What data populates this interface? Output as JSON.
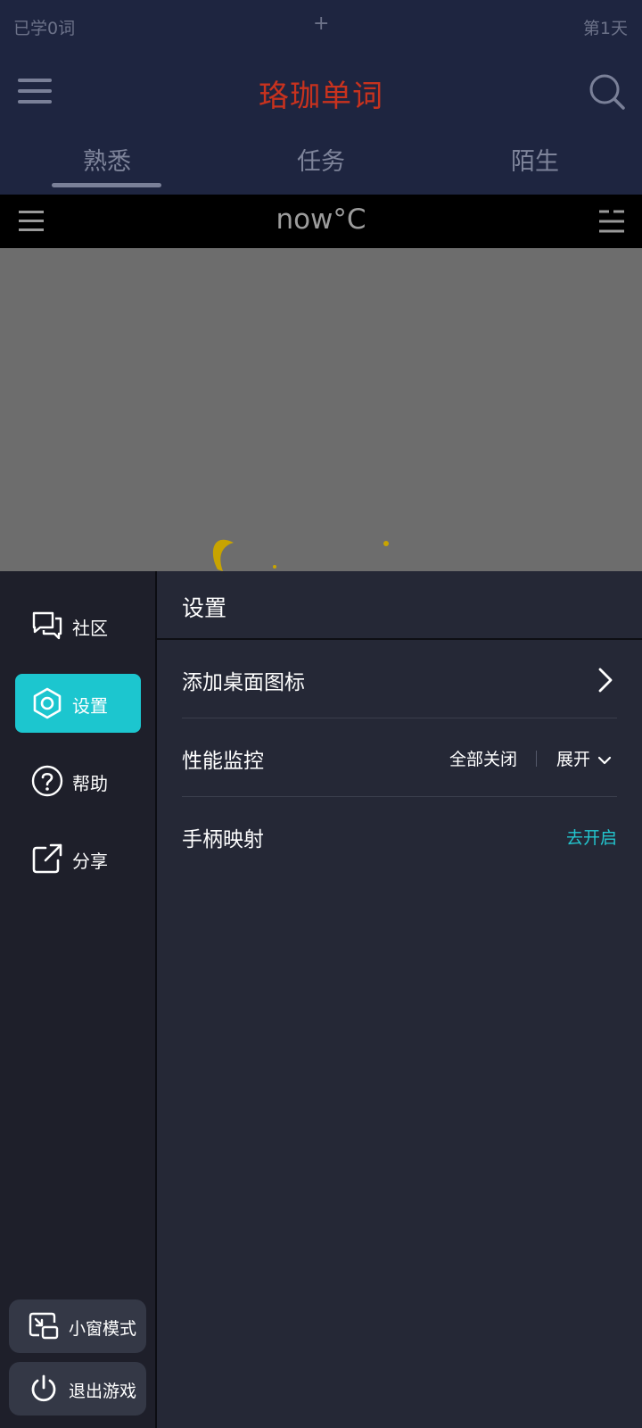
{
  "header": {
    "learned": "已学0词",
    "plus": "+",
    "day": "第1天",
    "title": "珞珈单词",
    "title_color": "#c8321e"
  },
  "tabs": [
    {
      "label": "熟悉",
      "active": true
    },
    {
      "label": "任务",
      "active": false
    },
    {
      "label": "陌生",
      "active": false
    }
  ],
  "weather_bar": {
    "title": "now°C"
  },
  "sidebar": {
    "items": [
      {
        "label": "社区",
        "icon": "chat-bubbles-icon",
        "active": false
      },
      {
        "label": "设置",
        "icon": "hexagon-settings-icon",
        "active": true
      },
      {
        "label": "帮助",
        "icon": "help-circle-icon",
        "active": false
      },
      {
        "label": "分享",
        "icon": "share-external-icon",
        "active": false
      }
    ],
    "active_color": "#1cc6cf",
    "bottom": [
      {
        "label": "小窗模式",
        "icon": "picture-in-picture-icon"
      },
      {
        "label": "退出游戏",
        "icon": "power-icon"
      }
    ]
  },
  "settings": {
    "title": "设置",
    "rows": [
      {
        "label": "添加桌面图标",
        "action_icon": "chevron-right-icon"
      },
      {
        "label": "性能监控",
        "value": "全部关闭",
        "toggle": "展开"
      },
      {
        "label": "手柄映射",
        "link": "去开启",
        "link_color": "#23c6cf"
      }
    ]
  }
}
